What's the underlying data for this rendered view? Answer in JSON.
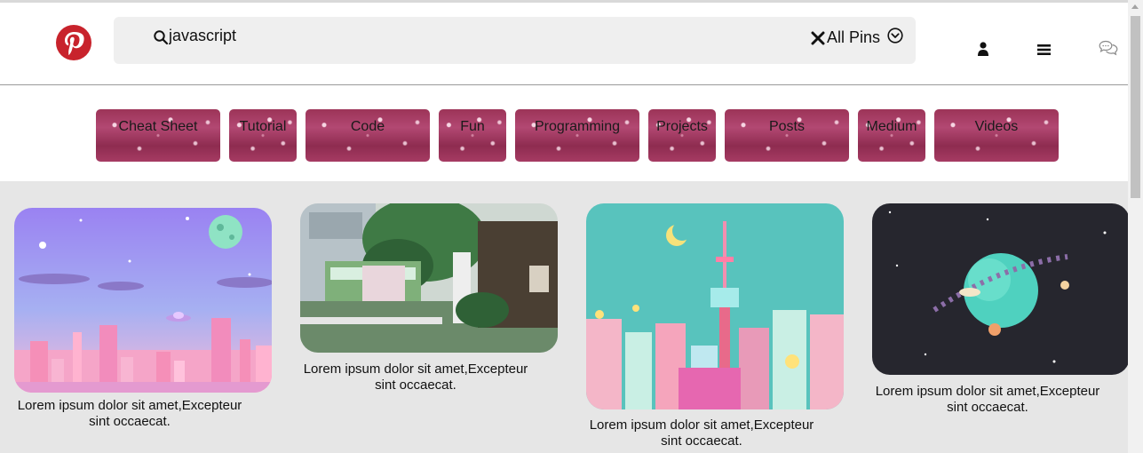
{
  "header": {
    "search": {
      "value": "javascript",
      "placeholder": "Search"
    },
    "scope_label": "All Pins"
  },
  "categories": [
    "Cheat Sheet",
    "Tutorial",
    "Code",
    "Fun",
    "Programming",
    "Projects",
    "Posts",
    "Medium",
    "Videos"
  ],
  "pins": [
    {
      "caption_line1": "Lorem ipsum dolor sit amet,Excepteur",
      "caption_line2": "sint occaecat."
    },
    {
      "caption_line1": "Lorem ipsum dolor sit amet,Excepteur",
      "caption_line2": "sint occaecat."
    },
    {
      "caption_line1": "Lorem ipsum dolor sit amet,Excepteur",
      "caption_line2": "sint occaecat."
    },
    {
      "caption_line1": "Lorem ipsum dolor sit amet,Excepteur",
      "caption_line2": "sint occaecat."
    }
  ],
  "colors": {
    "brand": "#c8232c",
    "chip": "#a63b63",
    "feed_bg": "#e6e6e6",
    "search_bg": "#efefef"
  }
}
